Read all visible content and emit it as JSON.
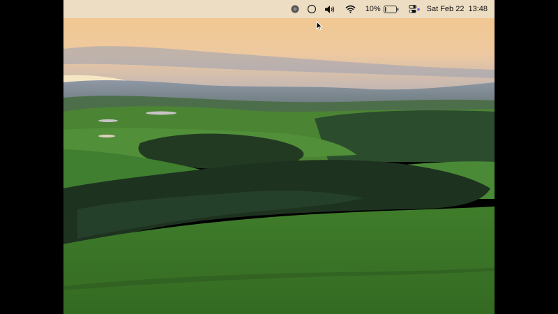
{
  "menubar": {
    "status_items": [
      {
        "icon": "screen-record-icon"
      },
      {
        "icon": "siri-circle-icon"
      },
      {
        "icon": "volume-icon"
      },
      {
        "icon": "wifi-icon"
      }
    ],
    "battery_percent": "10%",
    "battery_level": 0.1,
    "control_center_icon": "control-center-icon",
    "date": "Sat Feb 22",
    "time": "13:48"
  },
  "desktop": {
    "wallpaper": "green-hills-sunset",
    "colors": {
      "sky_top": "#f2c98e",
      "sky_bottom": "#e9c7a0",
      "haze": "#b7b1b4",
      "hill_light": "#4e8a3a",
      "hill_dark": "#2a4a26",
      "forest": "#1f3320",
      "foreground": "#3e7a2a"
    }
  }
}
